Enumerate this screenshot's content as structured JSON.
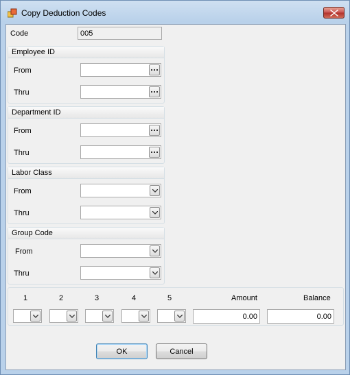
{
  "window": {
    "title": "Copy Deduction Codes"
  },
  "code": {
    "label": "Code",
    "value": "005"
  },
  "employee_id": {
    "title": "Employee ID",
    "from_label": "From",
    "thru_label": "Thru",
    "from_value": "",
    "thru_value": ""
  },
  "department_id": {
    "title": "Department ID",
    "from_label": "From",
    "thru_label": "Thru",
    "from_value": "",
    "thru_value": ""
  },
  "labor_class": {
    "title": "Labor Class",
    "from_label": "From",
    "thru_label": "Thru",
    "from_value": "",
    "thru_value": ""
  },
  "group_code": {
    "title": "Group Code",
    "from_label": "From",
    "thru_label": "Thru",
    "from_value": "",
    "thru_value": ""
  },
  "periods": {
    "headers": [
      "1",
      "2",
      "3",
      "4",
      "5"
    ],
    "amount_label": "Amount",
    "balance_label": "Balance",
    "amount_value": "0.00",
    "balance_value": "0.00"
  },
  "buttons": {
    "ok": "OK",
    "cancel": "Cancel"
  },
  "icons": {
    "app": "app-icon",
    "close": "close-icon",
    "browse": "ellipsis-icon",
    "dropdown": "chevron-down-icon"
  }
}
